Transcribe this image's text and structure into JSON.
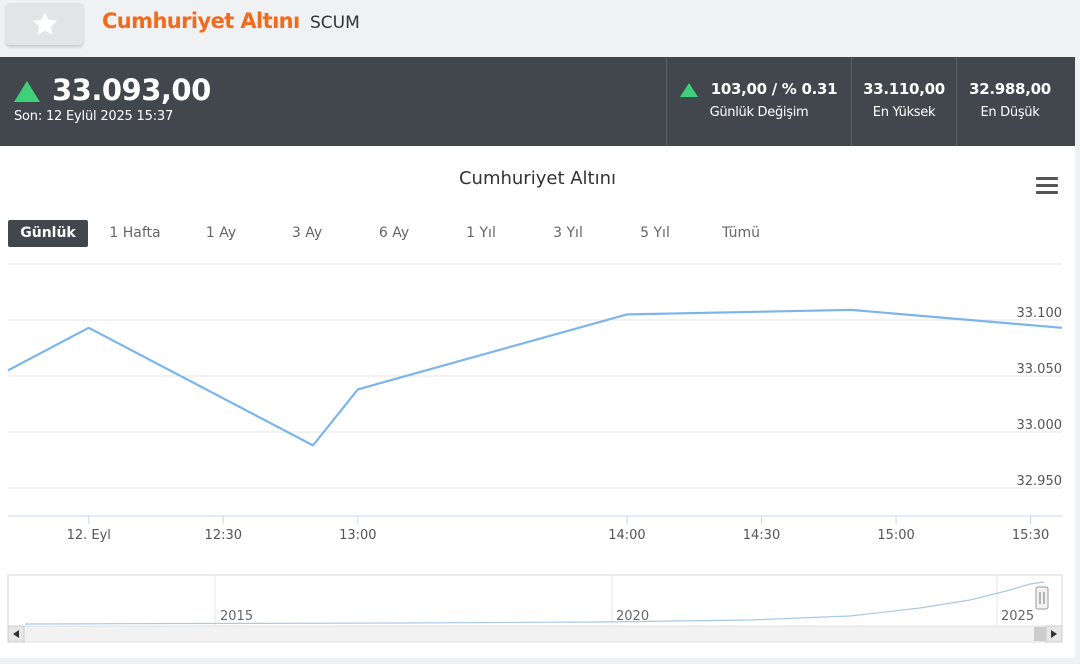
{
  "header": {
    "favorite_icon": "star-icon",
    "asset_name": "Cumhuriyet Altını",
    "asset_code": "SCUM"
  },
  "quote": {
    "price": "33.093,00",
    "direction": "up",
    "last_update": "Son: 12 Eylül 2025 15:37",
    "change_value": "103,00 / % 0.31",
    "change_label": "Günlük Değişim",
    "high_value": "33.110,00",
    "high_label": "En Yüksek",
    "low_value": "32.988,00",
    "low_label": "En Düşük",
    "up_color": "#3fd07a"
  },
  "chart": {
    "title": "Cumhuriyet Altını",
    "menu_icon": "hamburger-menu-icon",
    "ranges": [
      "Günlük",
      "1 Hafta",
      "1 Ay",
      "3 Ay",
      "6 Ay",
      "1 Yıl",
      "3 Yıl",
      "5 Yıl",
      "Tümü"
    ],
    "active_range": "Günlük",
    "line_color": "#7cb5ec"
  },
  "chart_data": {
    "type": "line",
    "title": "Cumhuriyet Altını",
    "xlabel": "",
    "ylabel": "",
    "x_tick_labels": [
      "12. Eyl",
      "12:30",
      "13:00",
      "14:00",
      "14:30",
      "15:00",
      "15:30"
    ],
    "y_tick_labels": [
      "33.100",
      "33.050",
      "33.000",
      "32.950"
    ],
    "y_ticks": [
      33100,
      33050,
      33000,
      32950
    ],
    "ylim": [
      32925,
      33150
    ],
    "x": [
      "11:42",
      "12:00",
      "12:50",
      "13:00",
      "14:00",
      "14:50",
      "15:37"
    ],
    "series": [
      {
        "values": [
          33055,
          33093,
          32988,
          33038,
          33105,
          33109,
          33093
        ]
      }
    ],
    "grid": true,
    "navigator": {
      "labels": [
        "2015",
        "2020",
        "2025"
      ]
    }
  }
}
